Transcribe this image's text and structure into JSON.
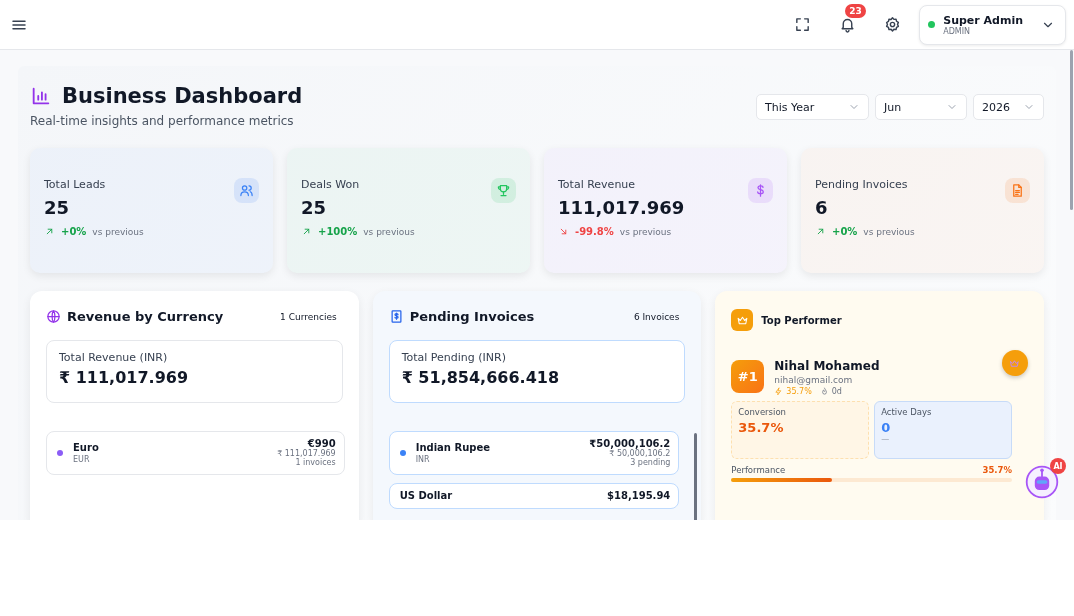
{
  "header": {
    "notifications": "23",
    "user": {
      "name": "Super Admin",
      "role": "ADMIN",
      "online": true
    }
  },
  "dashboard": {
    "title": "Business Dashboard",
    "subtitle": "Real-time insights and performance metrics",
    "filters": [
      {
        "value": "This Year"
      },
      {
        "value": "Jun"
      },
      {
        "value": "2026"
      }
    ],
    "stats": [
      {
        "kind": "leads",
        "label": "Total Leads",
        "value": "25",
        "change": "+0%",
        "rising": true,
        "note": "vs previous",
        "color": "#3b82f6"
      },
      {
        "kind": "deals",
        "label": "Deals Won",
        "value": "25",
        "change": "+100%",
        "rising": true,
        "note": "vs previous",
        "color": "#22c55e"
      },
      {
        "kind": "revenue",
        "label": "Total Revenue",
        "value": "111,017.969",
        "change": "-99.8%",
        "rising": false,
        "note": "vs previous",
        "color": "#a855f7"
      },
      {
        "kind": "invoices",
        "label": "Pending Invoices",
        "value": "6",
        "change": "+0%",
        "rising": true,
        "note": "vs previous",
        "color": "#f97316"
      }
    ]
  },
  "revenue_by_currency": {
    "title": "Revenue by Currency",
    "count": "1 Currencies",
    "total_label": "Total Revenue (INR)",
    "total": "₹ 111,017.969",
    "rows": [
      {
        "name": "Euro",
        "code": "EUR",
        "amount": "€990",
        "converted": "₹ 111,017.969",
        "count": "1 invoices",
        "color": "#8b5cf6"
      }
    ]
  },
  "pending_invoices": {
    "title": "Pending Invoices",
    "count": "6 Invoices",
    "total_label": "Total Pending (INR)",
    "total": "₹ 51,854,666.418",
    "rows": [
      {
        "name": "Indian Rupee",
        "code": "INR",
        "amount": "₹50,000,106.2",
        "converted": "₹ 50,000,106.2",
        "count": "3 pending",
        "color": "#3b82f6"
      },
      {
        "name": "US Dollar",
        "amount": "$18,195.94"
      }
    ]
  },
  "top_performer": {
    "title": "Top Performer",
    "rank": "#1",
    "name": "Nihal Mohamed",
    "email": "nihal@gmail.com",
    "rate": "35.7%",
    "days": "0d",
    "metrics": [
      {
        "label": "Conversion",
        "value": "35.7%",
        "kind": "conversion"
      },
      {
        "label": "Active Days",
        "value": "0",
        "sub": "—",
        "kind": "days"
      }
    ],
    "performance": {
      "label": "Performance",
      "reading": "35.7%",
      "level": 0.357
    }
  },
  "assistant": {
    "badge": "AI"
  }
}
